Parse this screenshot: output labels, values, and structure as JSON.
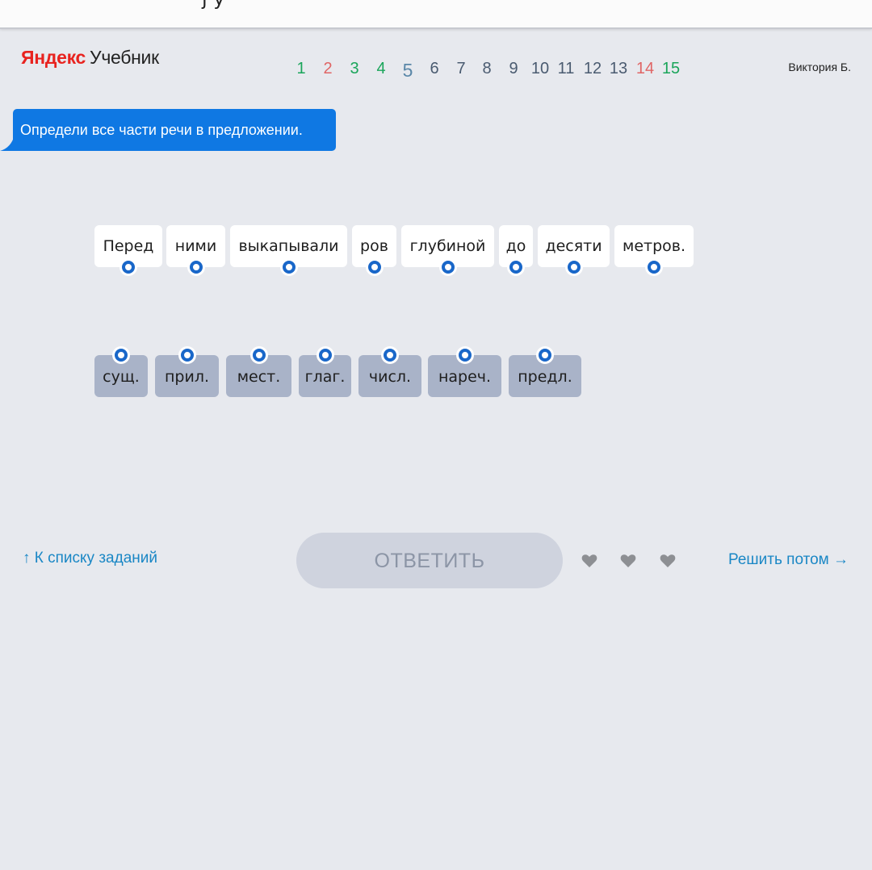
{
  "colors": {
    "correct": "#1aa55a",
    "wrong": "#e06565",
    "current": "#5a87a8",
    "pending": "#4a5b70",
    "accent": "#0f78e3",
    "link": "#1a87c5"
  },
  "header": {
    "logo_brand": "Яндекс",
    "logo_product": "Учебник",
    "pages": [
      {
        "label": "1",
        "status": "correct"
      },
      {
        "label": "2",
        "status": "wrong"
      },
      {
        "label": "3",
        "status": "correct"
      },
      {
        "label": "4",
        "status": "correct"
      },
      {
        "label": "5",
        "status": "current"
      },
      {
        "label": "6",
        "status": "pending"
      },
      {
        "label": "7",
        "status": "pending"
      },
      {
        "label": "8",
        "status": "pending"
      },
      {
        "label": "9",
        "status": "pending"
      },
      {
        "label": "10",
        "status": "pending"
      },
      {
        "label": "11",
        "status": "pending"
      },
      {
        "label": "12",
        "status": "pending"
      },
      {
        "label": "13",
        "status": "pending"
      },
      {
        "label": "14",
        "status": "wrong"
      },
      {
        "label": "15",
        "status": "correct"
      }
    ],
    "user_name": "Виктория Б."
  },
  "task": {
    "instruction": "Определи все части речи в предложении."
  },
  "sentence": {
    "words": [
      "Перед",
      "ними",
      "выкапывали",
      "ров",
      "глубиной",
      "до",
      "десяти",
      "метров."
    ]
  },
  "parts_of_speech": {
    "tags": [
      "сущ.",
      "прил.",
      "мест.",
      "глаг.",
      "числ.",
      "нареч.",
      "предл."
    ]
  },
  "footer": {
    "back_link": "↑ К списку заданий",
    "answer_button": "ОТВЕТИТЬ",
    "lives": 3,
    "heart_icon": "heart-icon",
    "later_link": "Решить потом →"
  }
}
